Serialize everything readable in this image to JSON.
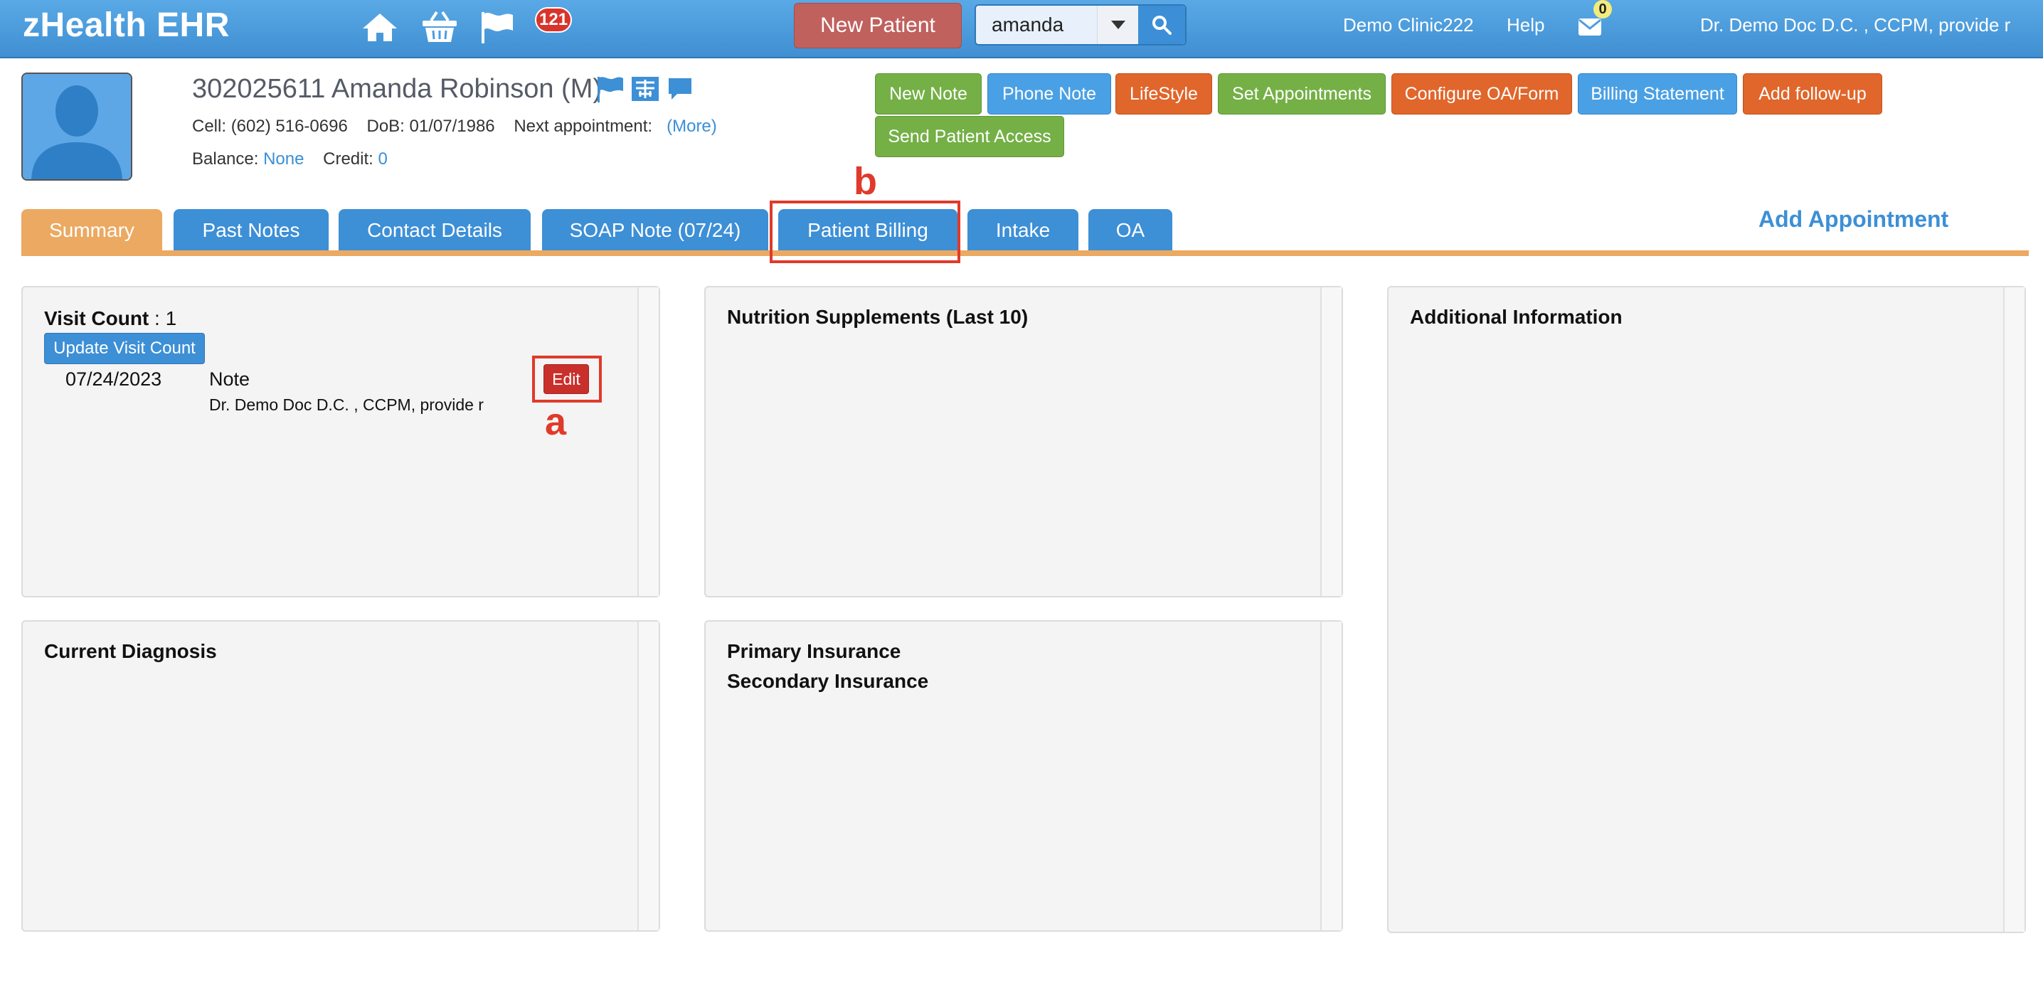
{
  "app": {
    "brand": "zHealth EHR",
    "notifications_count": "121",
    "new_patient_label": "New Patient",
    "search": {
      "value": "amanda"
    },
    "clinic": "Demo Clinic222",
    "help": "Help",
    "mail_count": "0",
    "user": "Dr. Demo Doc D.C. , CCPM, provide r"
  },
  "patient": {
    "title": "302025611 Amanda Robinson (M)",
    "cell_label": "Cell:",
    "cell": "(602) 516-0696",
    "dob_label": "DoB:",
    "dob": "01/07/1986",
    "next_appt_label": "Next appointment:",
    "next_appt_link": "(More)",
    "balance_label": "Balance:",
    "balance": "None",
    "credit_label": "Credit:",
    "credit": "0"
  },
  "actions": {
    "new_note": "New Note",
    "phone_note": "Phone Note",
    "lifestyle": "LifeStyle",
    "set_appointments": "Set Appointments",
    "configure_oa": "Configure OA/Form",
    "billing_statement": "Billing Statement",
    "add_followup": "Add follow-up",
    "send_patient_access": "Send Patient Access"
  },
  "tabs": [
    {
      "label": "Summary"
    },
    {
      "label": "Past Notes"
    },
    {
      "label": "Contact Details"
    },
    {
      "label": "SOAP Note (07/24)"
    },
    {
      "label": "Patient Billing"
    },
    {
      "label": "Intake"
    },
    {
      "label": "OA"
    }
  ],
  "add_appointment": "Add Appointment",
  "annotations": {
    "a": "a",
    "b": "b"
  },
  "panels": {
    "visit": {
      "count_label": "Visit Count",
      "count_sep": " : ",
      "count": "1",
      "update_btn": "Update Visit Count",
      "note_date": "07/24/2023",
      "note_type": "Note",
      "note_doctor": "Dr. Demo Doc D.C. , CCPM, provide r",
      "edit_label": "Edit"
    },
    "nutrition_title": "Nutrition Supplements (Last 10)",
    "additional_title": "Additional Information",
    "diagnosis_title": "Current Diagnosis",
    "primary_insurance": "Primary Insurance",
    "secondary_insurance": "Secondary Insurance"
  },
  "colors": {
    "topbar": "#4a9ee0",
    "active_tab": "#eba961",
    "tab": "#3d8fd6",
    "annotation": "#e03a2a"
  }
}
